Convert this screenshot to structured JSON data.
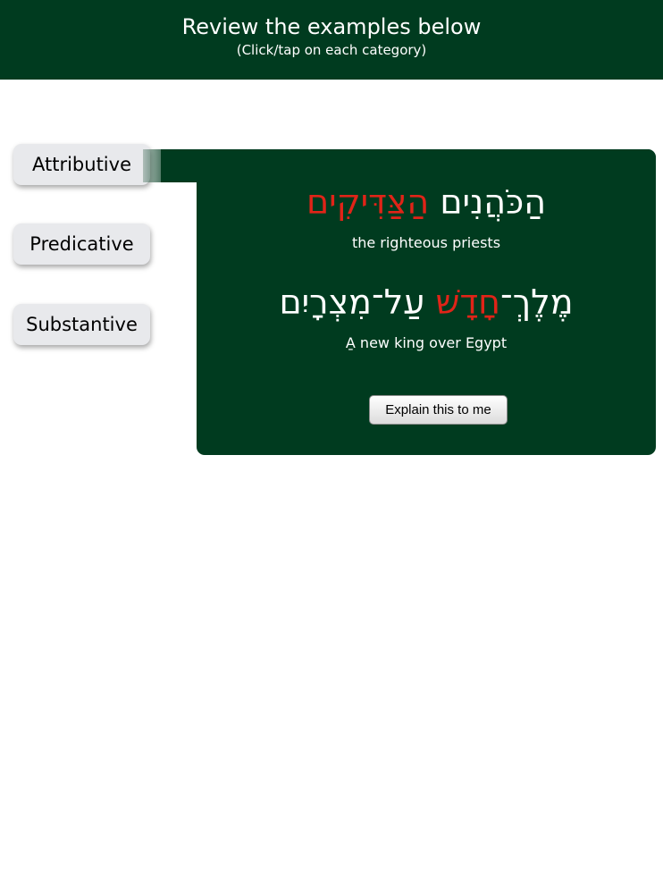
{
  "header": {
    "title": "Review the examples below",
    "subtitle": "(Click/tap on each category)"
  },
  "tabs": [
    {
      "label": "Attributive",
      "active": true
    },
    {
      "label": "Predicative",
      "active": false
    },
    {
      "label": "Substantive",
      "active": false
    }
  ],
  "examples": [
    {
      "hebrew_plain": "הַכֹּהֲנִים",
      "hebrew_highlight": "הַצַּדִּיקִים",
      "translation": "the righteous priests"
    },
    {
      "hebrew_plain_1": "מֶלֶךְ־",
      "hebrew_highlight": "חָדָשׁ",
      "hebrew_plain_2": " עַל־מִצְרָיִם",
      "translation": "A̱ new king over Egypt"
    }
  ],
  "explain_button_label": "Explain this to me",
  "colors": {
    "header_bg": "#003b1f",
    "panel_bg": "#003b1f",
    "highlight": "#e02418",
    "tab_bg": "#e8e9ec"
  }
}
